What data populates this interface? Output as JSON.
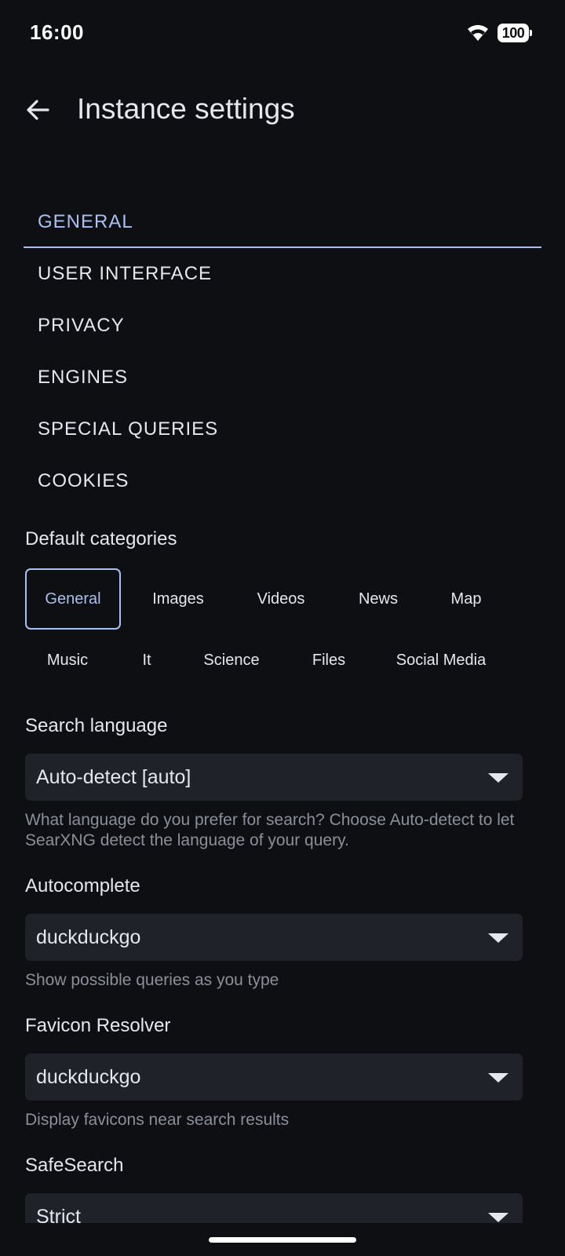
{
  "status_bar": {
    "time": "16:00",
    "battery_level": "100"
  },
  "app_bar": {
    "title": "Instance settings"
  },
  "tabs": [
    {
      "label": "GENERAL",
      "active": true
    },
    {
      "label": "USER INTERFACE",
      "active": false
    },
    {
      "label": "PRIVACY",
      "active": false
    },
    {
      "label": "ENGINES",
      "active": false
    },
    {
      "label": "SPECIAL QUERIES",
      "active": false
    },
    {
      "label": "COOKIES",
      "active": false
    }
  ],
  "default_categories": {
    "label": "Default categories",
    "row1": [
      "General",
      "Images",
      "Videos",
      "News",
      "Map"
    ],
    "row2": [
      "Music",
      "It",
      "Science",
      "Files",
      "Social Media"
    ],
    "selected": "General"
  },
  "search_language": {
    "label": "Search language",
    "value": "Auto-detect [auto]",
    "help": "What language do you prefer for search? Choose Auto-detect to let SearXNG detect the language of your query."
  },
  "autocomplete": {
    "label": "Autocomplete",
    "value": "duckduckgo",
    "help": "Show possible queries as you type"
  },
  "favicon_resolver": {
    "label": "Favicon Resolver",
    "value": "duckduckgo",
    "help": "Display favicons near search results"
  },
  "safesearch": {
    "label": "SafeSearch",
    "value": "Strict"
  },
  "colors": {
    "background": "#0e0f13",
    "accent": "#a9c0ef",
    "field_background": "#1f2229",
    "help_text": "#8c8f98"
  }
}
